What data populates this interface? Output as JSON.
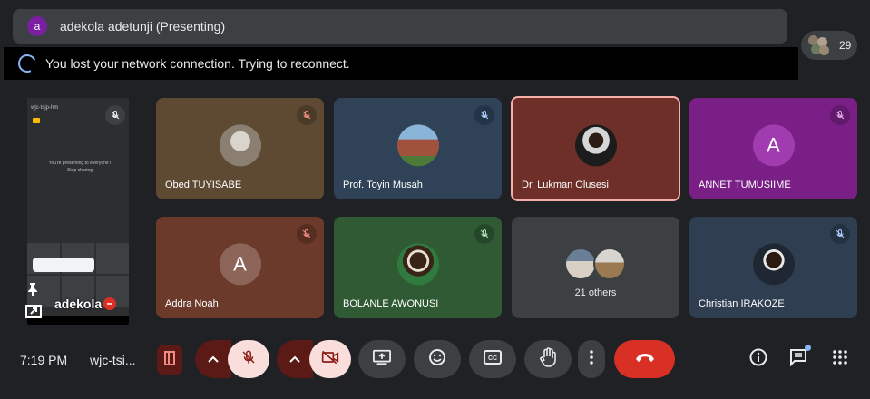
{
  "presenting": {
    "avatar_letter": "a",
    "text": "adekola adetunji (Presenting)"
  },
  "reconnect": {
    "message": "You lost your network connection. Trying to reconnect."
  },
  "participants_count": "29",
  "self": {
    "name": "adekola",
    "phone_topbar": "wjc-tsjp-hm",
    "phone_message": "You're presenting to everyone / Stop sharing"
  },
  "tiles": [
    {
      "name": "Obed TUYISABE",
      "bg": "#5e4a33",
      "mic_bg": "#4a3a28",
      "kind": "photo"
    },
    {
      "name": "Prof. Toyin Musah",
      "bg": "#2f4257",
      "mic_bg": "#233447",
      "kind": "photo"
    },
    {
      "name": "Dr. Lukman Olusesi",
      "bg": "#6e2f29",
      "mic_bg": "#57241f",
      "kind": "photo"
    },
    {
      "name": "ANNET TUMUSIIME",
      "bg": "#7a1f86",
      "mic_bg": "#621a6c",
      "kind": "letter",
      "letter": "A",
      "letter_bg": "#a03cb0"
    },
    {
      "name": "Addra Noah",
      "bg": "#6b3a2b",
      "mic_bg": "#552d21",
      "kind": "letter",
      "letter": "A",
      "letter_bg": "#8d6558"
    },
    {
      "name": "BOLANLE AWONUSI",
      "bg": "#2f5a34",
      "mic_bg": "#244729",
      "kind": "photo"
    },
    {
      "name": "21 others",
      "bg": "#3c4043",
      "kind": "others"
    },
    {
      "name": "Christian IRAKOZE",
      "bg": "#2f3e51",
      "mic_bg": "#243140",
      "kind": "photo"
    }
  ],
  "bottom": {
    "time": "7:19 PM",
    "meeting_code": "wjc-tsi..."
  },
  "colors": {
    "background": "#202124",
    "end_call": "#d93025",
    "muted_bg": "#f9dedc",
    "muted_icon": "#8c1d18",
    "accent": "#8ab4f8"
  }
}
